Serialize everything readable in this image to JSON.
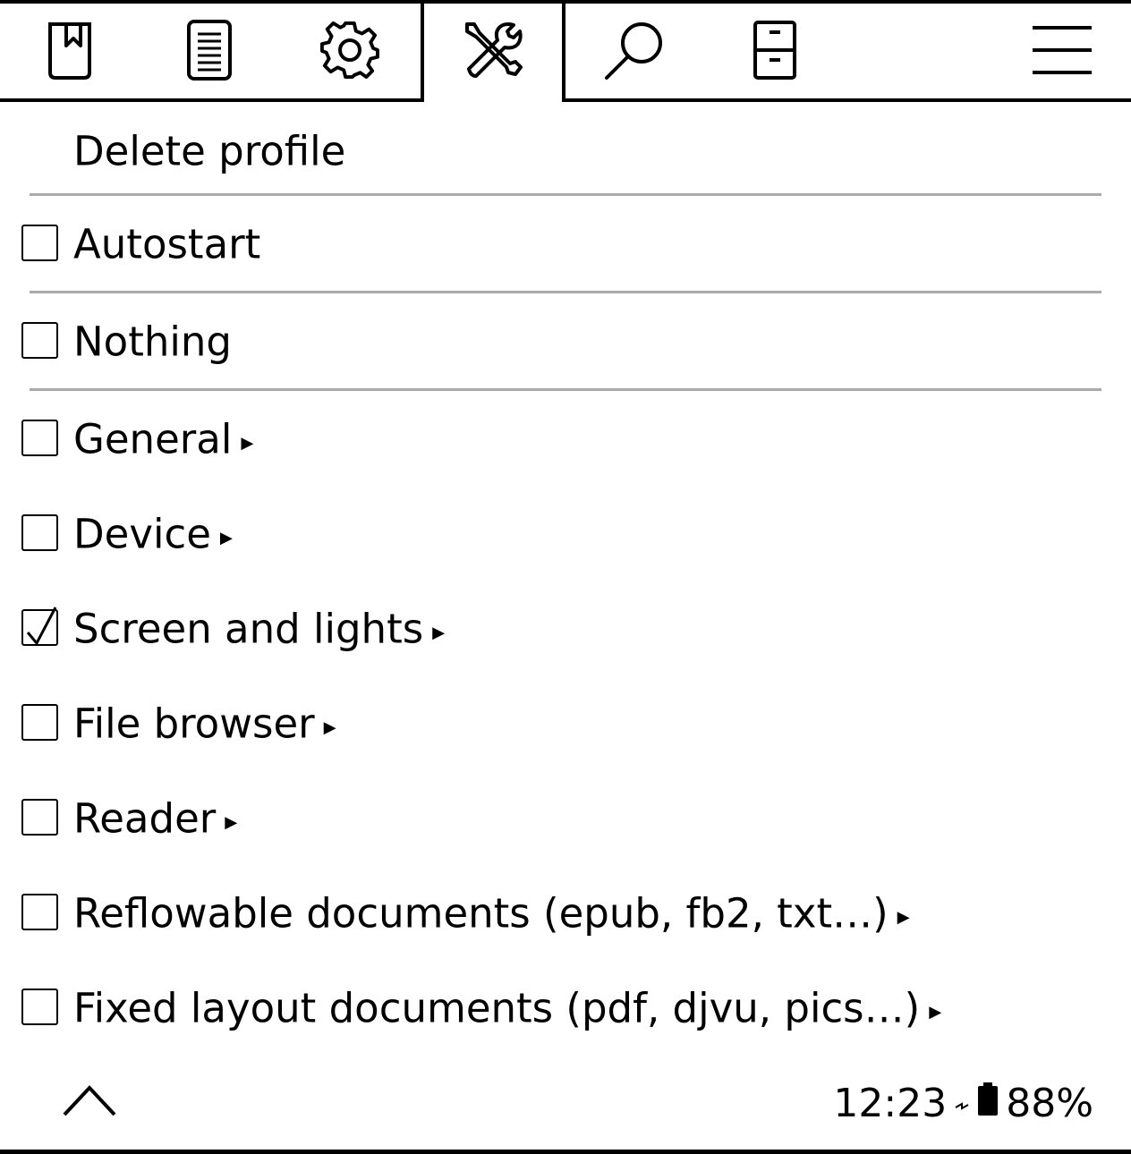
{
  "tabbar": {
    "tabs": [
      {
        "icon": "bookmark-icon",
        "active": false
      },
      {
        "icon": "document-icon",
        "active": false
      },
      {
        "icon": "gear-icon",
        "active": false
      },
      {
        "icon": "tools-icon",
        "active": true
      },
      {
        "icon": "search-icon",
        "active": false
      },
      {
        "icon": "filing-cabinet-icon",
        "active": false
      }
    ],
    "menu_icon": "hamburger-menu-icon"
  },
  "menu": {
    "items": [
      {
        "label": "Delete profile",
        "checkbox": false,
        "checked": false,
        "submenu": false
      },
      {
        "label": "Autostart",
        "checkbox": true,
        "checked": false,
        "submenu": false
      },
      {
        "label": "Nothing",
        "checkbox": true,
        "checked": false,
        "submenu": false
      },
      {
        "label": "General",
        "checkbox": true,
        "checked": false,
        "submenu": true
      },
      {
        "label": "Device",
        "checkbox": true,
        "checked": false,
        "submenu": true
      },
      {
        "label": "Screen and lights",
        "checkbox": true,
        "checked": true,
        "submenu": true
      },
      {
        "label": "File browser",
        "checkbox": true,
        "checked": false,
        "submenu": true
      },
      {
        "label": "Reader",
        "checkbox": true,
        "checked": false,
        "submenu": true
      },
      {
        "label": "Reflowable documents (epub, fb2, txt…)",
        "checkbox": true,
        "checked": false,
        "submenu": true
      },
      {
        "label": "Fixed layout documents (pdf, djvu, pics…)",
        "checkbox": true,
        "checked": false,
        "submenu": true
      }
    ],
    "submenu_arrow": "▸"
  },
  "footer": {
    "up_icon": "chevron-up-icon",
    "time": "12:23",
    "battery_percent": "88%",
    "charging_icon": "charging-icon",
    "battery_icon": "battery-icon"
  }
}
